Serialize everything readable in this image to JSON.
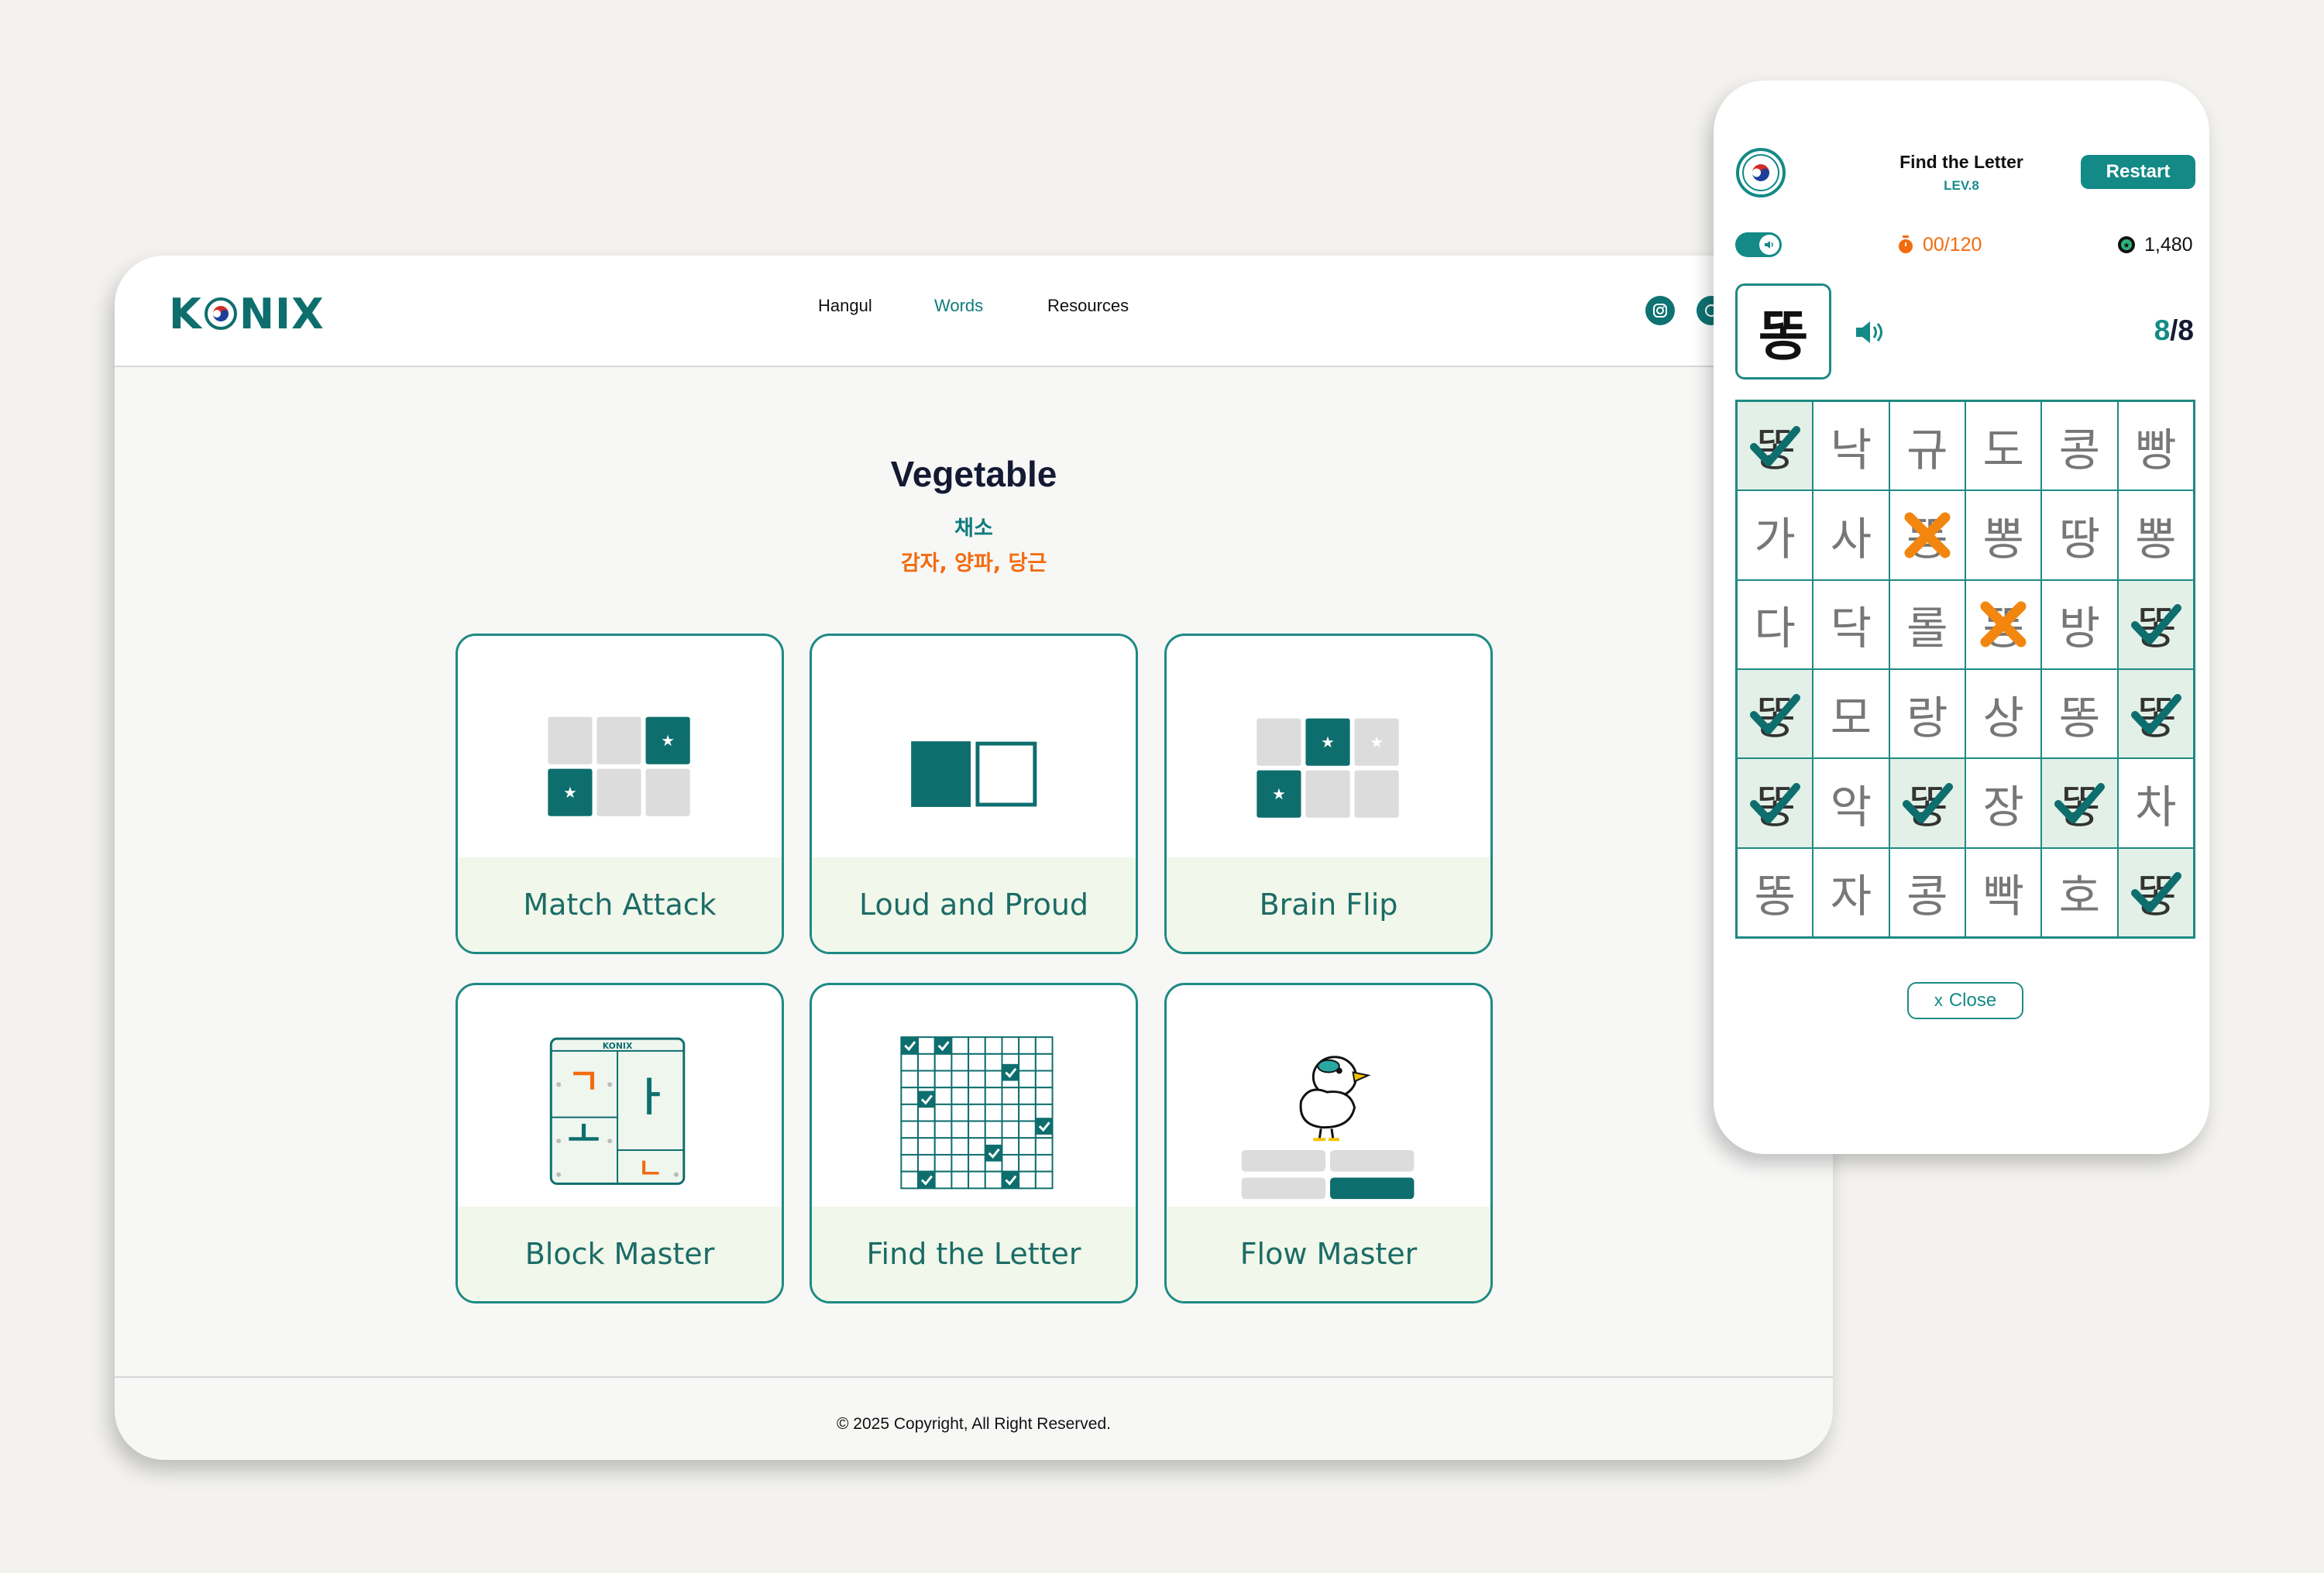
{
  "site": {
    "logo": "K   NIX",
    "nav": [
      "Hangul",
      "Words",
      "Resources"
    ],
    "active_nav": "Words"
  },
  "category": {
    "title": "Vegetable",
    "korean": "채소",
    "examples": "감자, 양파, 당근"
  },
  "games": [
    {
      "label": "Match Attack",
      "icon": "match-attack-icon"
    },
    {
      "label": "Loud and Proud",
      "icon": "loud-and-proud-icon"
    },
    {
      "label": "Brain Flip",
      "icon": "brain-flip-icon"
    },
    {
      "label": "Block Master",
      "icon": "block-master-icon"
    },
    {
      "label": "Find the Letter",
      "icon": "find-the-letter-icon"
    },
    {
      "label": "Flow Master",
      "icon": "flow-master-icon"
    }
  ],
  "block_master_art": {
    "brand": "KONIX",
    "j1": "ㄱ",
    "j2": "ㅏ",
    "j3": "ㅗ",
    "j4": "ㄴ"
  },
  "footer": {
    "copyright": "© 2025 Copyright, All Right Reserved."
  },
  "colors": {
    "primary": "#138a86",
    "accent": "#f26b0f",
    "dark": "#151a33"
  },
  "panel": {
    "title": "Find the Letter",
    "level": "LEV.8",
    "restart": "Restart",
    "timer": "00/120",
    "score": "1,480",
    "target": "똥",
    "progress_found": "8",
    "progress_total": "/8",
    "close": "Close",
    "close_icon": "x",
    "grid": [
      [
        "똥",
        "낙",
        "규",
        "도",
        "콩",
        "빵"
      ],
      [
        "가",
        "사",
        "똥",
        "뽕",
        "땅",
        "뽕"
      ],
      [
        "다",
        "닥",
        "롤",
        "똥",
        "방",
        "똥"
      ],
      [
        "똥",
        "모",
        "랑",
        "상",
        "똥",
        "똥"
      ],
      [
        "똥",
        "악",
        "똥",
        "장",
        "똥",
        "차"
      ],
      [
        "똥",
        "자",
        "콩",
        "빡",
        "호",
        "똥"
      ]
    ],
    "marks": [
      [
        "check",
        "",
        "",
        "",
        "",
        ""
      ],
      [
        "",
        "",
        "cross",
        "",
        "",
        ""
      ],
      [
        "",
        "",
        "",
        "cross",
        "",
        "check"
      ],
      [
        "check",
        "",
        "",
        "",
        "",
        "check"
      ],
      [
        "check",
        "",
        "check",
        "",
        "check",
        ""
      ],
      [
        "",
        "",
        "",
        "",
        "",
        "check"
      ]
    ]
  }
}
